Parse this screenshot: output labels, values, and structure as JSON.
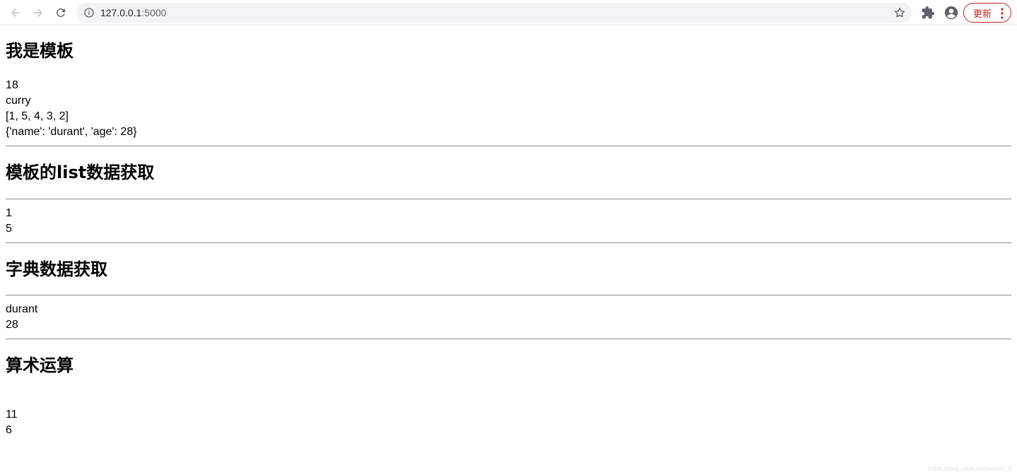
{
  "browser": {
    "url_host": "127.0.0.1",
    "url_port": ":5000",
    "update_label": "更新"
  },
  "sections": {
    "template": {
      "title": "我是模板",
      "values": [
        "18",
        "curry",
        "[1, 5, 4, 3, 2]",
        "{'name': 'durant', 'age': 28}"
      ]
    },
    "list": {
      "title": "模板的list数据获取",
      "values": [
        "1",
        "5"
      ]
    },
    "dict": {
      "title": "字典数据获取",
      "values": [
        "durant",
        "28"
      ]
    },
    "arithmetic": {
      "title": "算术运算",
      "values": [
        "11",
        "6"
      ]
    }
  },
  "watermark": "https://blog.csdn.net/weixin_4"
}
